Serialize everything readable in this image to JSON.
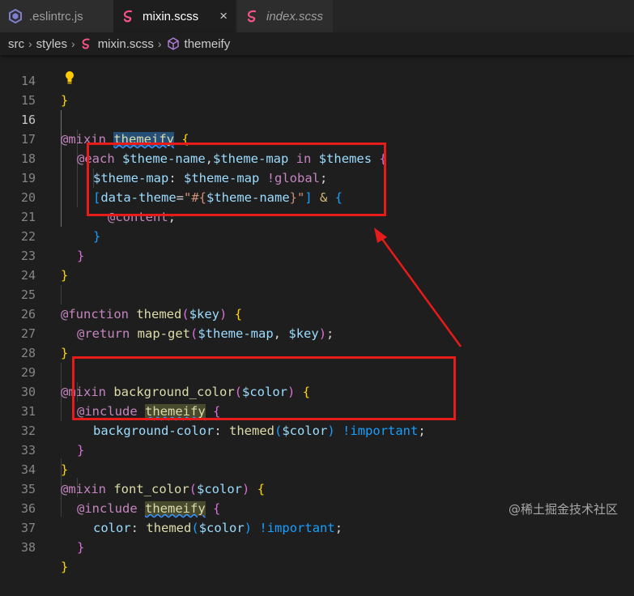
{
  "tabs": [
    {
      "label": ".eslintrc.js",
      "icon": "eslint-icon",
      "active": false,
      "italic": false
    },
    {
      "label": "mixin.scss",
      "icon": "sass-icon",
      "active": true,
      "italic": false,
      "close": "×"
    },
    {
      "label": "index.scss",
      "icon": "sass-icon",
      "active": false,
      "italic": true
    }
  ],
  "breadcrumb": {
    "items": [
      "src",
      "styles",
      "mixin.scss",
      "themeify"
    ],
    "separator": "›"
  },
  "editor": {
    "current_line": 16,
    "lines": [
      {
        "n": "14",
        "text": "}"
      },
      {
        "n": "15",
        "text": ""
      },
      {
        "n": "16",
        "text": "@mixin themeify {"
      },
      {
        "n": "17",
        "text": "@each $theme-name,$theme-map in $themes {"
      },
      {
        "n": "18",
        "text": "$theme-map: $theme-map !global;"
      },
      {
        "n": "19",
        "text": "[data-theme=\"#{$theme-name}\"] & {"
      },
      {
        "n": "20",
        "text": "@content;"
      },
      {
        "n": "21",
        "text": "}"
      },
      {
        "n": "22",
        "text": "}"
      },
      {
        "n": "23",
        "text": "}"
      },
      {
        "n": "24",
        "text": ""
      },
      {
        "n": "25",
        "text": "@function themed($key) {"
      },
      {
        "n": "26",
        "text": "@return map-get($theme-map, $key);"
      },
      {
        "n": "27",
        "text": "}"
      },
      {
        "n": "28",
        "text": ""
      },
      {
        "n": "29",
        "text": "@mixin background_color($color) {"
      },
      {
        "n": "30",
        "text": "@include themeify {"
      },
      {
        "n": "31",
        "text": "background-color: themed($color) !important;"
      },
      {
        "n": "32",
        "text": "}"
      },
      {
        "n": "33",
        "text": "}"
      },
      {
        "n": "34",
        "text": "@mixin font_color($color) {"
      },
      {
        "n": "35",
        "text": "@include themeify {"
      },
      {
        "n": "36",
        "text": "color: themed($color) !important;"
      },
      {
        "n": "37",
        "text": "}"
      },
      {
        "n": "38",
        "text": "}"
      }
    ]
  },
  "watermark": "@稀土掘金技术社区",
  "colors": {
    "annotation": "#e81b1b",
    "background": "#1e1e1e",
    "keyword": "#c586c0",
    "variable": "#9cdcfe",
    "function": "#dcdcaa"
  }
}
